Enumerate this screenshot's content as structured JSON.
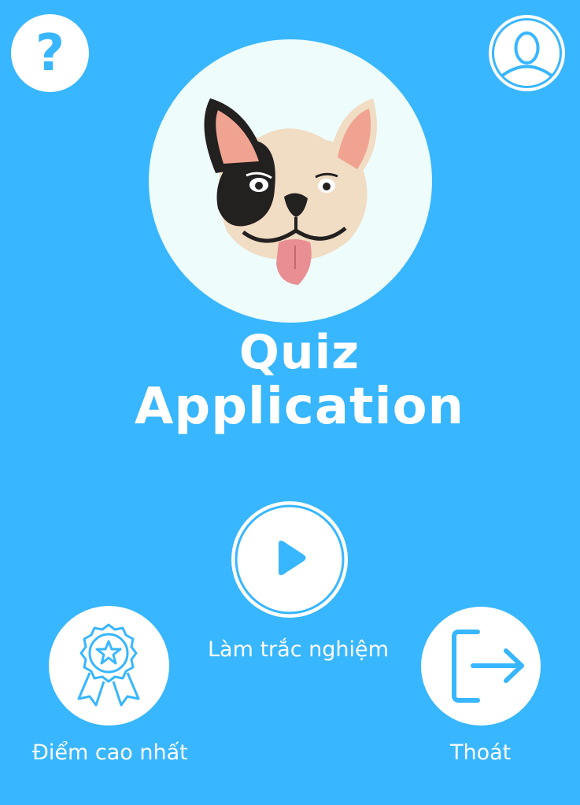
{
  "app": {
    "title_line1": "Quiz",
    "title_line2": "Application"
  },
  "header": {
    "help_icon_glyph": "?",
    "help_icon": "question-icon",
    "profile_icon": "user-icon"
  },
  "logo": {
    "icon": "dog-face-icon"
  },
  "actions": {
    "play_label": "Làm trắc nghiệm",
    "play_icon": "play-icon",
    "score_label": "Điểm cao nhất",
    "score_icon": "award-ribbon-icon",
    "exit_label": "Thoát",
    "exit_icon": "exit-icon"
  },
  "colors": {
    "background": "#38b6ff",
    "icon_fill": "#ffffff",
    "accent": "#38b6ff"
  }
}
